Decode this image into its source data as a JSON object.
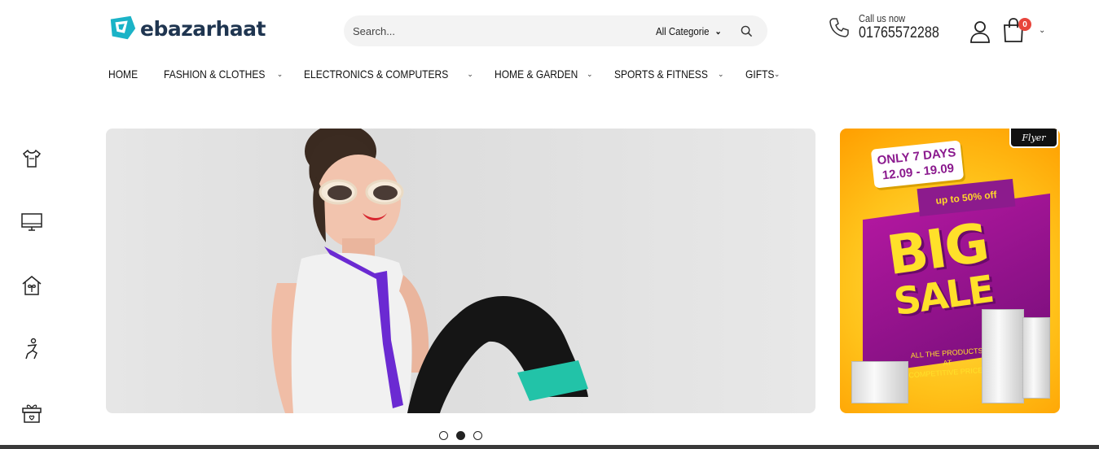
{
  "brand": {
    "name": "ebazarhaat",
    "accent": "#1bb3c7",
    "dark": "#1f3550"
  },
  "search": {
    "placeholder": "Search...",
    "category": "All Categorie"
  },
  "contact": {
    "label": "Call us now",
    "phone": "01765572288"
  },
  "cart": {
    "count": "0"
  },
  "nav": [
    {
      "label": "HOME",
      "has_dropdown": false
    },
    {
      "label": "FASHION & CLOTHES",
      "has_dropdown": true
    },
    {
      "label": "ELECTRONICS & COMPUTERS",
      "has_dropdown": true
    },
    {
      "label": "HOME & GARDEN",
      "has_dropdown": true
    },
    {
      "label": "SPORTS & FITNESS",
      "has_dropdown": true
    },
    {
      "label": "GIFTS",
      "has_dropdown": true
    }
  ],
  "side_categories": [
    "tshirt-icon",
    "monitor-icon",
    "house-plant-icon",
    "fitness-icon",
    "gift-icon"
  ],
  "slider": {
    "slides": 3,
    "active_index": 1
  },
  "banner": {
    "tag": "Flyer",
    "headline": "ONLY 7 DAYS",
    "dates": "12.09 - 19.09",
    "discount": "up to 50% off",
    "big": "BIG",
    "sale": "SALE",
    "note_line1": "ALL THE PRODUCTS AT",
    "note_line2": "COMPETITIVE PRICES"
  }
}
